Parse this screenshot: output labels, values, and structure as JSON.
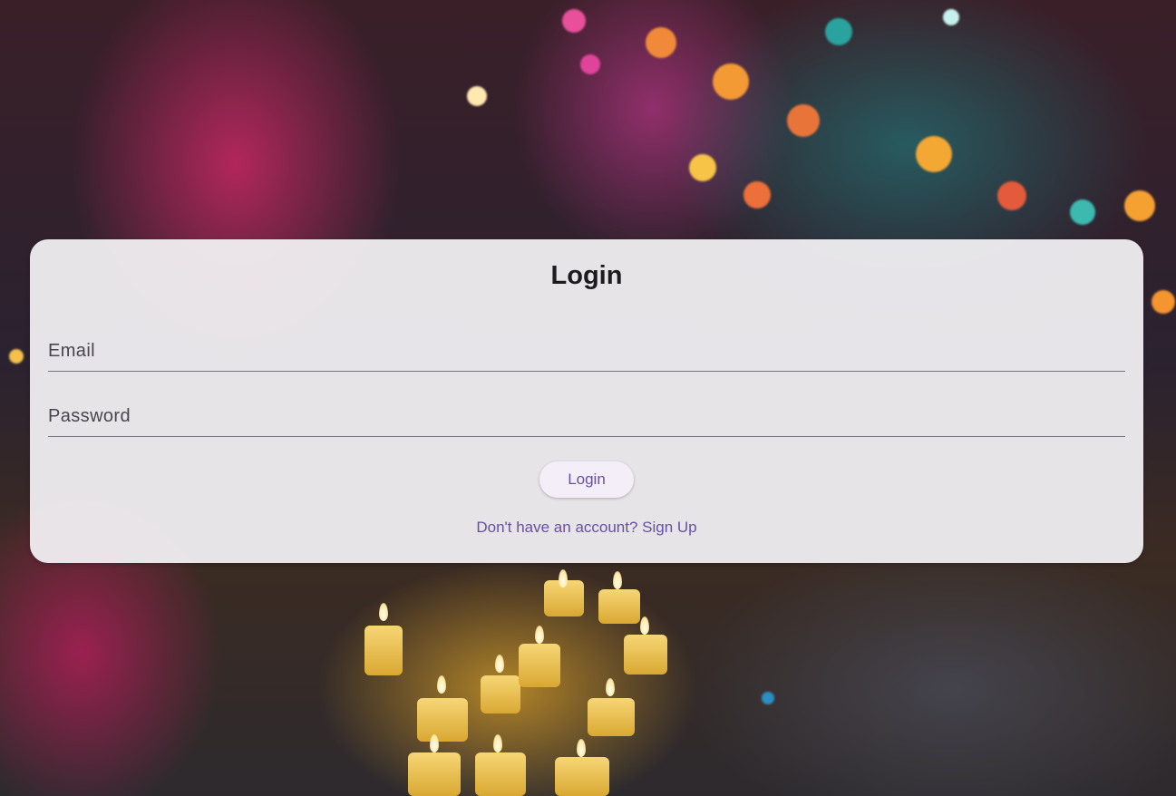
{
  "page": {
    "title": "Login"
  },
  "form": {
    "email_placeholder": "Email",
    "email_value": "",
    "password_placeholder": "Password",
    "password_value": "",
    "login_button_label": "Login",
    "signup_link_text": "Don't have an account? Sign Up"
  },
  "theme": {
    "accent_color": "#6750a4",
    "card_color": "#f2f0f3",
    "text_color": "#1d1b20"
  }
}
